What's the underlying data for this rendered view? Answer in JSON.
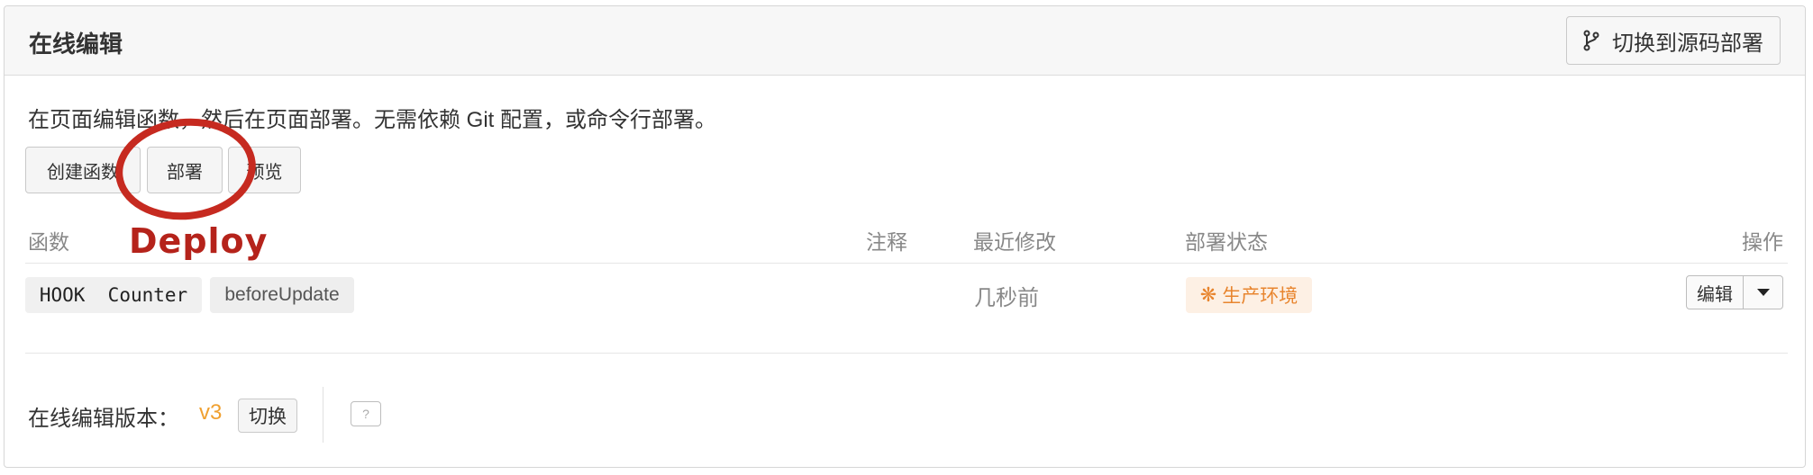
{
  "panel": {
    "title": "在线编辑",
    "switch_source_button": "切换到源码部署",
    "description": "在页面编辑函数，然后在页面部署。无需依赖 Git 配置，或命令行部署。"
  },
  "actions": {
    "create_function": "创建函数",
    "deploy": "部署",
    "preview": "预览"
  },
  "table": {
    "headers": {
      "function": "函数",
      "note": "注释",
      "last_modified": "最近修改",
      "deploy_status": "部署状态",
      "operations": "操作"
    },
    "rows": [
      {
        "function_name": "HOOK  Counter",
        "hook": "beforeUpdate",
        "note": "",
        "last_modified": "几秒前",
        "status": "生产环境",
        "edit_label": "编辑"
      }
    ]
  },
  "version": {
    "label": "在线编辑版本：",
    "value": "v3",
    "switch_label": "切换",
    "help": "?"
  },
  "annotation": {
    "text": "Deploy",
    "color": "#c62a20"
  },
  "colors": {
    "status_orange": "#e8852e",
    "version_orange": "#f0a030"
  }
}
